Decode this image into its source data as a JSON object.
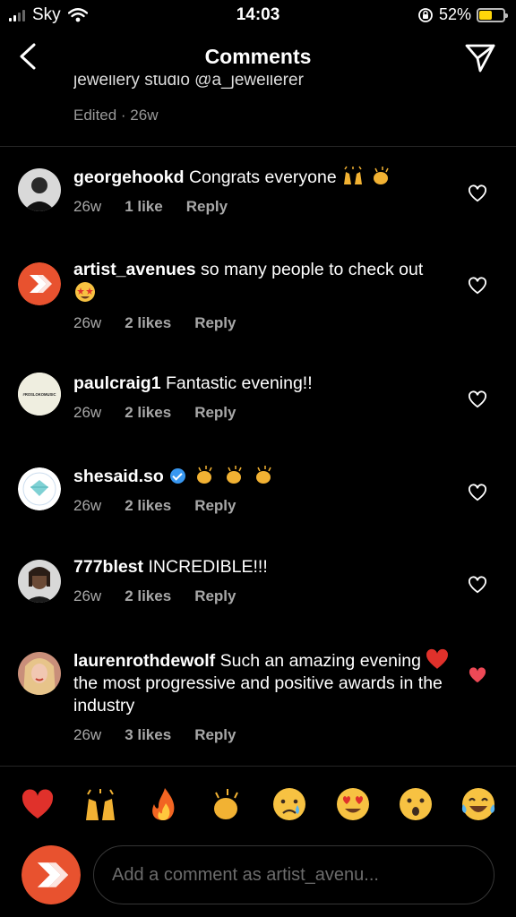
{
  "status": {
    "carrier": "Sky",
    "time": "14:03",
    "battery_pct": "52%",
    "battery_level": 0.52
  },
  "nav": {
    "title": "Comments"
  },
  "previous": {
    "caption_fragment": "jewellery studio @a_jewellerer",
    "meta": "Edited · 26w"
  },
  "comments": [
    {
      "user": "georgehookd",
      "text": "Congrats everyone",
      "emojis": [
        "raising-hands",
        "clapping-hands"
      ],
      "age": "26w",
      "likes": "1 like",
      "reply": "Reply",
      "liked": false
    },
    {
      "user": "artist_avenues",
      "text": "so many people to check out",
      "emojis": [
        "star-struck"
      ],
      "age": "26w",
      "likes": "2 likes",
      "reply": "Reply",
      "liked": false
    },
    {
      "user": "paulcraig1",
      "text": "Fantastic evening!!",
      "emojis": [],
      "age": "26w",
      "likes": "2 likes",
      "reply": "Reply",
      "liked": false
    },
    {
      "user": "shesaid.so",
      "verified": true,
      "text": "",
      "emojis": [
        "clapping-hands",
        "clapping-hands",
        "clapping-hands"
      ],
      "age": "26w",
      "likes": "2 likes",
      "reply": "Reply",
      "liked": false
    },
    {
      "user": "777blest",
      "text": "INCREDIBLE!!!",
      "emojis": [],
      "age": "26w",
      "likes": "2 likes",
      "reply": "Reply",
      "liked": false
    },
    {
      "user": "laurenrothdewolf",
      "text_a": "Such an amazing evening",
      "text_b": "the most progressive and positive awards in the industry",
      "emojis": [
        "red-heart"
      ],
      "age": "26w",
      "likes": "3 likes",
      "reply": "Reply",
      "liked": true
    }
  ],
  "avatars": {
    "paulcraig1_text": "#ROSLOKOMUSIC"
  },
  "quick_reactions": [
    "red-heart",
    "raising-hands",
    "fire",
    "clapping-hands",
    "crying-face",
    "heart-eyes",
    "surprised-face",
    "tears-of-joy"
  ],
  "composer": {
    "placeholder": "Add a comment as artist_avenu..."
  },
  "colors": {
    "background": "#000000",
    "muted": "#a8a8a8",
    "like_red": "#ed4956",
    "brand_orange": "#e8522f",
    "verified_blue": "#3897f0"
  }
}
